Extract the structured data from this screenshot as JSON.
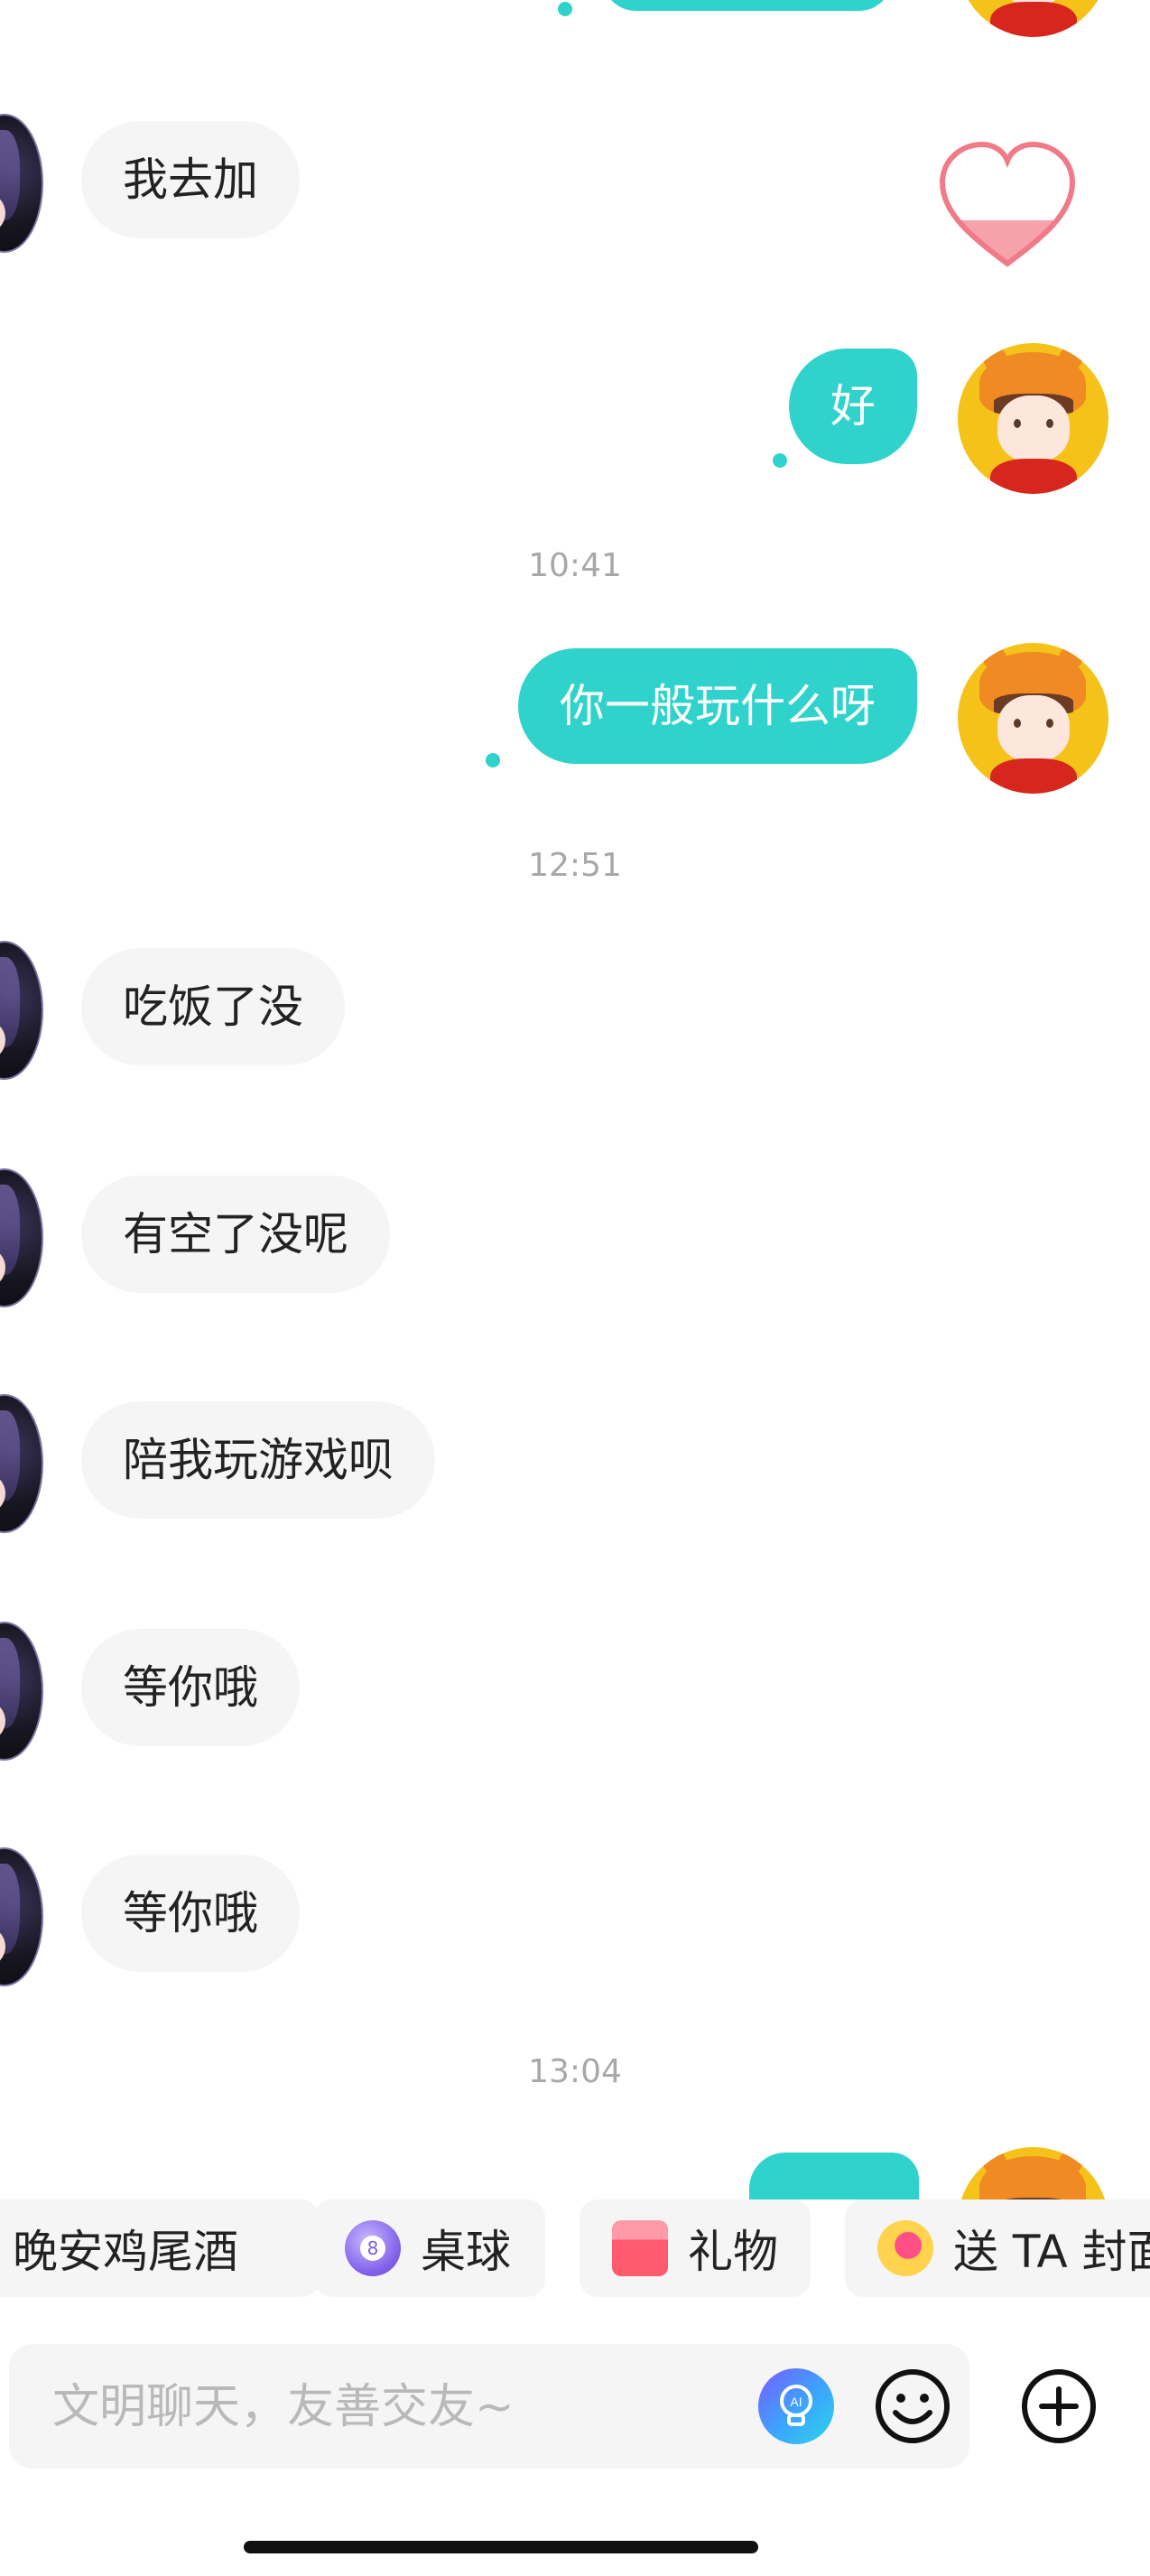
{
  "messages": {
    "m1": "我去加",
    "m2": "好",
    "m3": "你一般玩什么呀",
    "m4": "吃饭了没",
    "m5": "有空了没呢",
    "m6": "陪我玩游戏呗",
    "m7": "等你哦",
    "m8": "等你哦"
  },
  "timestamps": {
    "t1": "10:41",
    "t2": "12:51",
    "t3": "13:04"
  },
  "quick_actions": {
    "a1": "晚安鸡尾酒",
    "a2": "桌球",
    "a3": "礼物",
    "a4": "送 TA 封面"
  },
  "input": {
    "placeholder": "文明聊天，友善交友~"
  },
  "colors": {
    "accent": "#2fd3cb",
    "bubble_gray": "#f5f5f5"
  }
}
